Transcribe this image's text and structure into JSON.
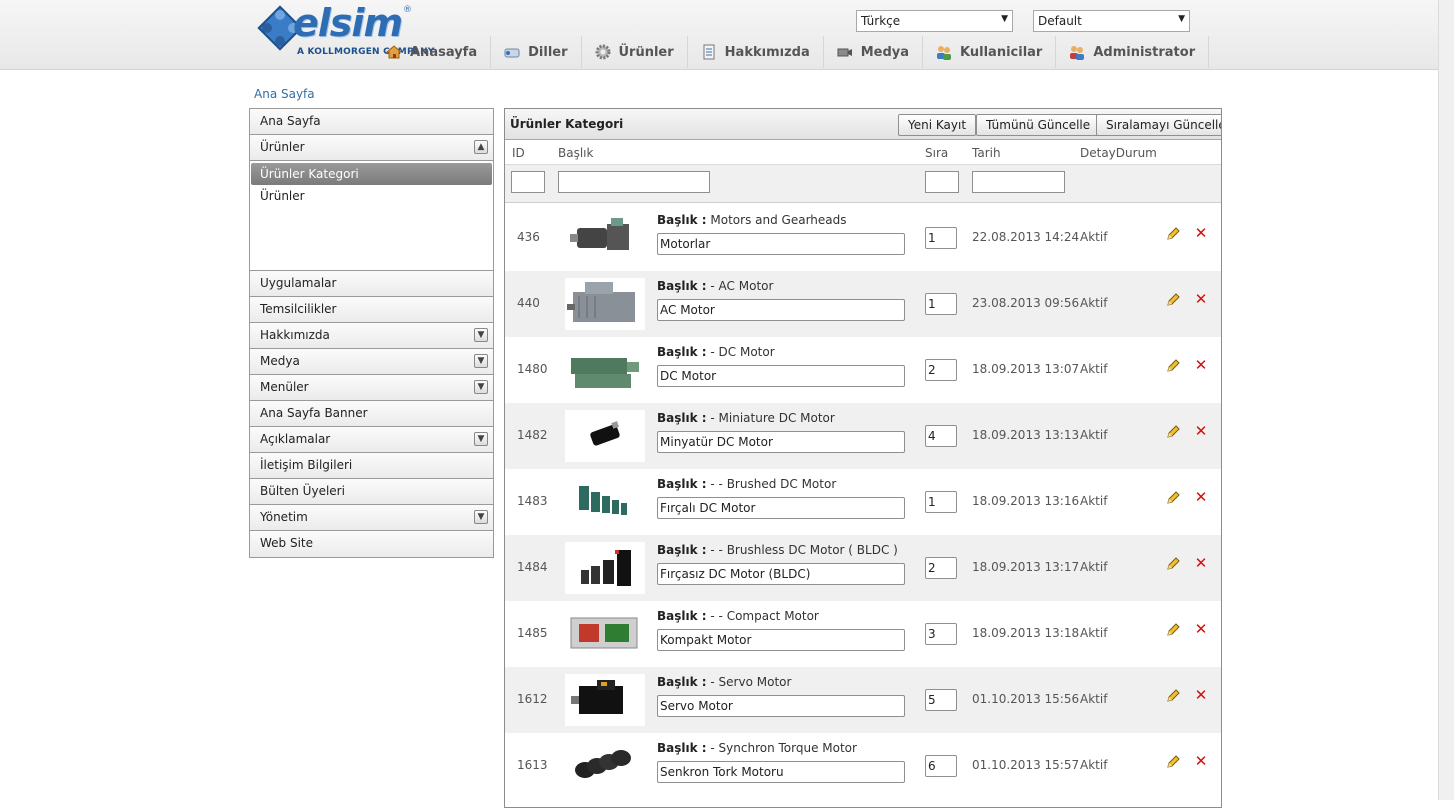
{
  "brand": {
    "name": "elsim",
    "registered": "®",
    "tagline": "A KOLLMORGEN COMPANY"
  },
  "selects": {
    "language": "Türkçe",
    "theme": "Default"
  },
  "nav": [
    {
      "label": "Anasayfa",
      "icon": "home-icon"
    },
    {
      "label": "Diller",
      "icon": "languages-icon"
    },
    {
      "label": "Ürünler",
      "icon": "gear-icon"
    },
    {
      "label": "Hakkımızda",
      "icon": "document-icon"
    },
    {
      "label": "Medya",
      "icon": "media-icon"
    },
    {
      "label": "Kullanicilar",
      "icon": "users-icon"
    },
    {
      "label": "Administrator",
      "icon": "admin-icon"
    }
  ],
  "breadcrumb": "Ana Sayfa",
  "sidebar": {
    "items": [
      {
        "label": "Ana Sayfa"
      },
      {
        "label": "Ürünler",
        "toggle": "▲"
      },
      {
        "label": "Uygulamalar"
      },
      {
        "label": "Temsilcilikler"
      },
      {
        "label": "Hakkımızda",
        "toggle": "▼"
      },
      {
        "label": "Medya",
        "toggle": "▼"
      },
      {
        "label": "Menüler",
        "toggle": "▼"
      },
      {
        "label": "Ana Sayfa Banner"
      },
      {
        "label": "Açıklamalar",
        "toggle": "▼"
      },
      {
        "label": "İletişim Bilgileri"
      },
      {
        "label": "Bülten Üyeleri"
      },
      {
        "label": "Yönetim",
        "toggle": "▼"
      },
      {
        "label": "Web Site"
      }
    ],
    "sub": [
      {
        "label": "Ürünler Kategori",
        "active": true
      },
      {
        "label": "Ürünler",
        "active": false
      }
    ]
  },
  "grid": {
    "title": "Ürünler Kategori",
    "buttons": {
      "new": "Yeni Kayıt",
      "update_all": "Tümünü Güncelle",
      "update_order": "Sıralamayı Güncelle"
    },
    "columns": {
      "id": "ID",
      "title": "Başlık",
      "order": "Sıra",
      "date": "Tarih",
      "status": "DetayDurum"
    },
    "title_prefix": "Başlık :",
    "rows": [
      {
        "id": "436",
        "label": "Motors and Gearheads",
        "value": "Motorlar",
        "order": "1",
        "date": "22.08.2013 14:24",
        "status": "Aktif",
        "img": "motor-gearhead"
      },
      {
        "id": "440",
        "label": "- AC Motor",
        "value": "AC Motor",
        "order": "1",
        "date": "23.08.2013 09:56",
        "status": "Aktif",
        "img": "ac-motor"
      },
      {
        "id": "1480",
        "label": "- DC Motor",
        "value": "DC Motor",
        "order": "2",
        "date": "18.09.2013 13:07",
        "status": "Aktif",
        "img": "dc-motor"
      },
      {
        "id": "1482",
        "label": "- Miniature DC Motor",
        "value": "Minyatür DC Motor",
        "order": "4",
        "date": "18.09.2013 13:13",
        "status": "Aktif",
        "img": "mini-dc"
      },
      {
        "id": "1483",
        "label": "- - Brushed DC Motor",
        "value": "Fırçalı DC Motor",
        "order": "1",
        "date": "18.09.2013 13:16",
        "status": "Aktif",
        "img": "brushed"
      },
      {
        "id": "1484",
        "label": "- - Brushless DC Motor ( BLDC )",
        "value": "Fırçasız DC Motor (BLDC)",
        "order": "2",
        "date": "18.09.2013 13:17",
        "status": "Aktif",
        "img": "brushless"
      },
      {
        "id": "1485",
        "label": "- - Compact Motor",
        "value": "Kompakt Motor",
        "order": "3",
        "date": "18.09.2013 13:18",
        "status": "Aktif",
        "img": "compact"
      },
      {
        "id": "1612",
        "label": "- Servo Motor",
        "value": "Servo Motor",
        "order": "5",
        "date": "01.10.2013 15:56",
        "status": "Aktif",
        "img": "servo"
      },
      {
        "id": "1613",
        "label": "- Synchron Torque Motor",
        "value": "Senkron Tork Motoru",
        "order": "6",
        "date": "01.10.2013 15:57",
        "status": "Aktif",
        "img": "torque"
      }
    ]
  },
  "colors": {
    "link": "#2f6fa8",
    "brand": "#2e6db4",
    "delete": "#d01010",
    "pencil": "#e8b020"
  }
}
